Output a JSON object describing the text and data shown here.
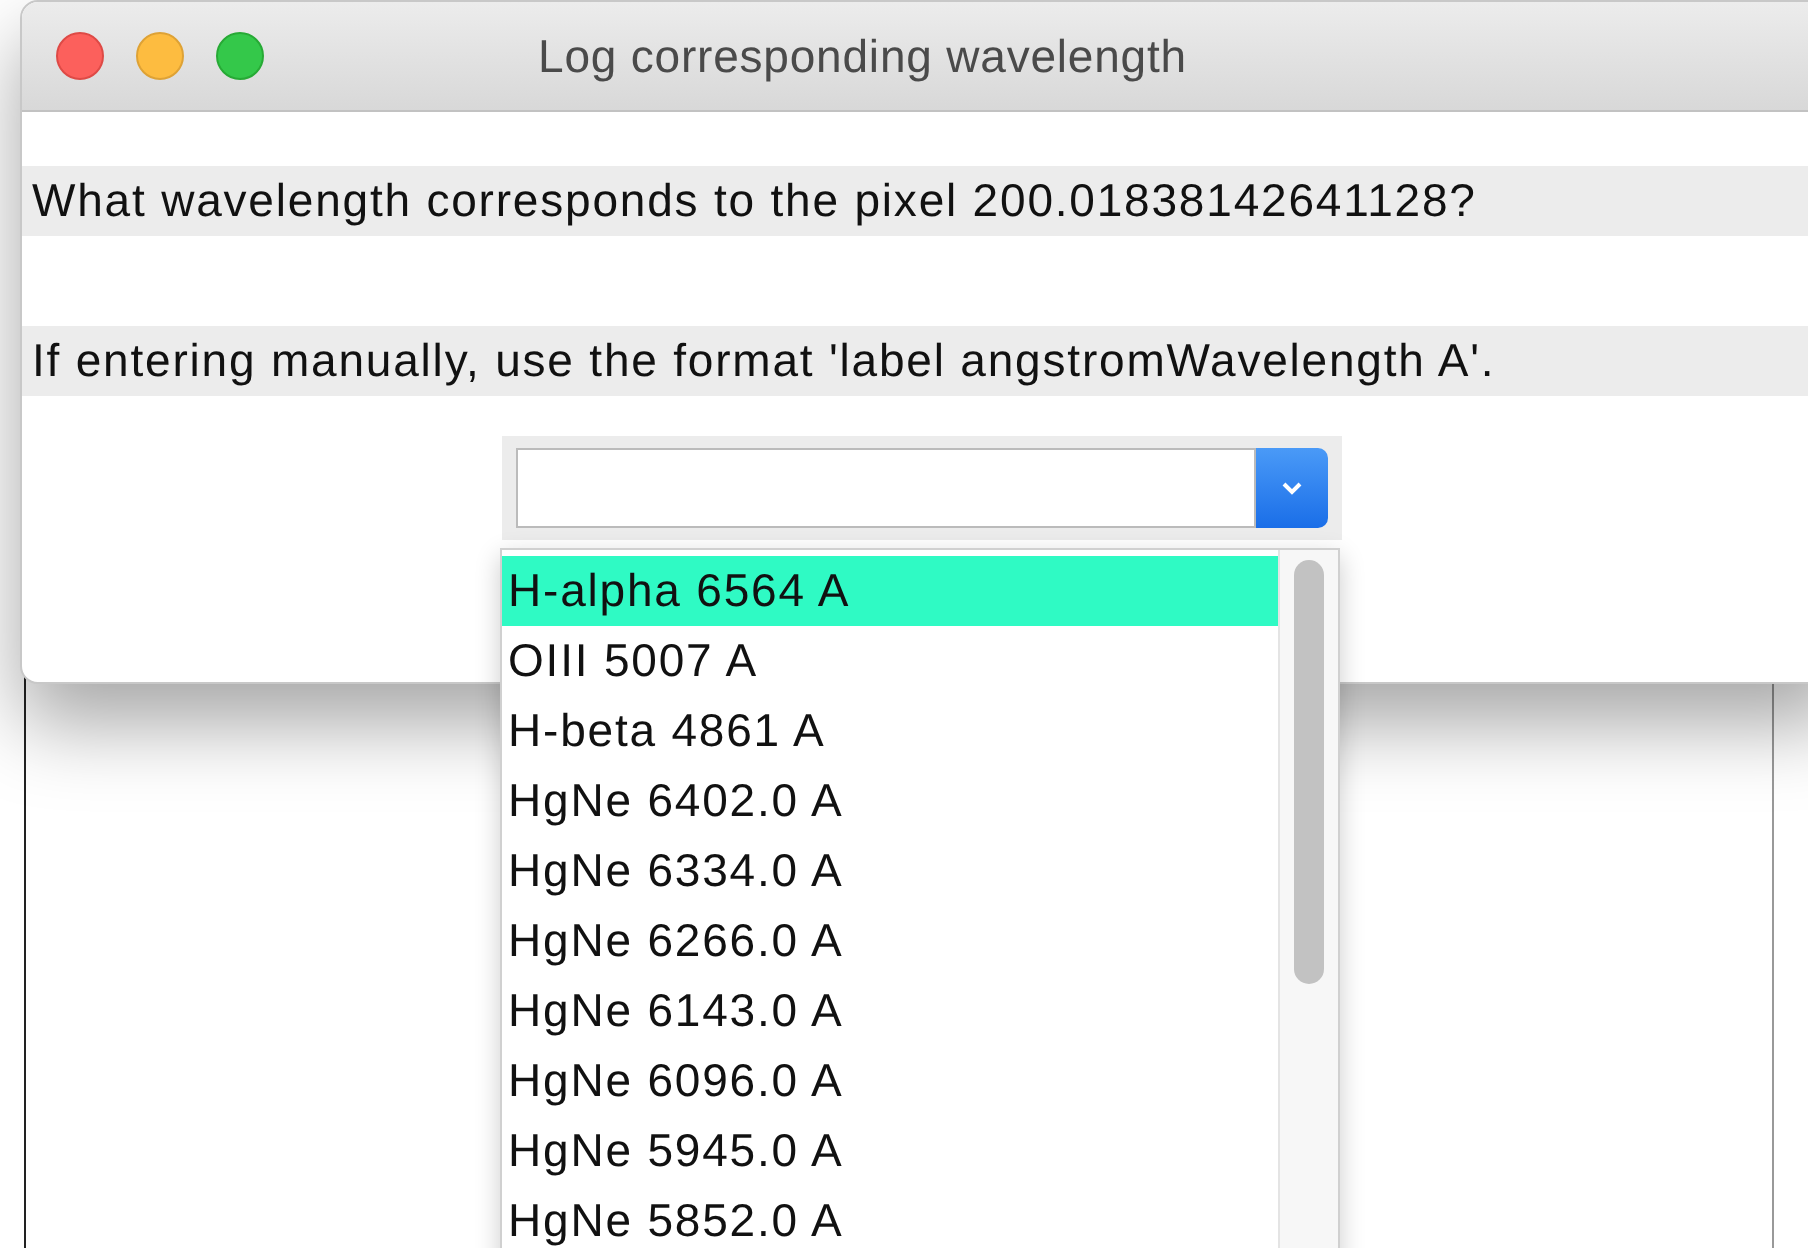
{
  "window": {
    "title": "Log corresponding wavelength"
  },
  "labels": [
    "What wavelength corresponds to the pixel 200.01838142641128?",
    "If entering manually, use the format 'label angstromWavelength A'."
  ],
  "combo": {
    "expanded": true,
    "options": [
      {
        "label": "H-alpha 6564 A",
        "selected": true
      },
      {
        "label": "OIII 5007 A",
        "selected": false
      },
      {
        "label": "H-beta 4861 A",
        "selected": false
      },
      {
        "label": "HgNe 6402.0 A",
        "selected": false
      },
      {
        "label": "HgNe 6334.0 A",
        "selected": false
      },
      {
        "label": "HgNe 6266.0 A",
        "selected": false
      },
      {
        "label": "HgNe 6143.0 A",
        "selected": false
      },
      {
        "label": "HgNe 6096.0 A",
        "selected": false
      },
      {
        "label": "HgNe 5945.0 A",
        "selected": false
      },
      {
        "label": "HgNe 5852.0 A",
        "selected": false
      }
    ]
  }
}
